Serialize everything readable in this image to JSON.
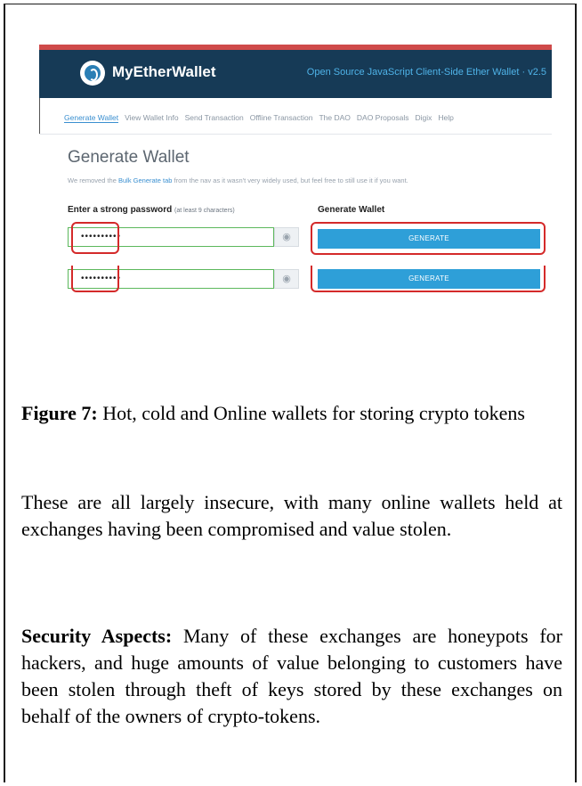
{
  "screenshot": {
    "brand": "MyEtherWallet",
    "tagline": "Open Source JavaScript Client-Side Ether Wallet · v2.5",
    "nav": [
      "Generate Wallet",
      "View Wallet Info",
      "Send Transaction",
      "Offline Transaction",
      "The DAO",
      "DAO Proposals",
      "Digix",
      "Help"
    ],
    "title": "Generate Wallet",
    "notice_prefix": "We removed the ",
    "notice_link": "Bulk Generate tab",
    "notice_suffix": " from the nav as it wasn't very widely used, but feel free to still use it if you want.",
    "password_label": "Enter a strong password",
    "password_hint": "(at least 9 characters)",
    "generate_label": "Generate Wallet",
    "password_value": "••••••••••",
    "eye_icon": "◉",
    "generate_button": "GENERATE",
    "colors": {
      "header_bg": "#163a56",
      "accent_bar": "#cf4a4a",
      "button_blue": "#2e9fd8",
      "highlight_red": "#d42a2a",
      "input_green": "#5cb85c"
    }
  },
  "caption": {
    "label": "Figure 7:",
    "text": " Hot, cold and Online wallets for storing crypto tokens"
  },
  "paragraph1": "These are all largely insecure, with many online wallets held at exchanges having been compromised and value stolen.",
  "paragraph2": {
    "label": "Security Aspects:",
    "text": " Many of these exchanges are honeypots for hackers, and huge amounts of value belonging to customers have been stolen through theft of keys stored by these exchanges on behalf of the owners of crypto-tokens."
  }
}
